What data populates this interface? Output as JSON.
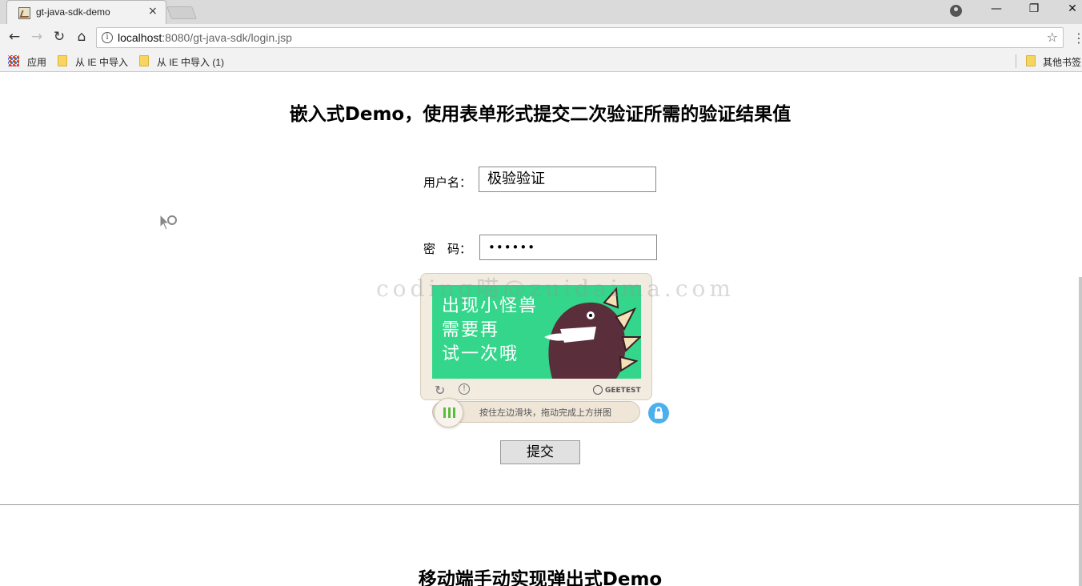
{
  "browser": {
    "tab_title": "gt-java-sdk-demo",
    "tab_close": "×",
    "url_host": "localhost",
    "url_path": ":8080/gt-java-sdk/login.jsp",
    "window_controls": {
      "minimize": "—",
      "maximize": "❐",
      "close": "✕"
    },
    "nav": {
      "back": "←",
      "forward": "→",
      "reload": "↻",
      "home": "⌂"
    },
    "star": "☆",
    "menu": "⋮",
    "info": "i"
  },
  "bookmarks": {
    "apps": "应用",
    "items": [
      "从 IE 中导入",
      "从 IE 中导入 (1)"
    ],
    "other": "其他书签"
  },
  "embed_demo": {
    "title": "嵌入式Demo，使用表单形式提交二次验证所需的验证结果值",
    "username_label": "用户名：",
    "username_value": "极验验证",
    "password_label": "密　码：",
    "password_value": "••••••",
    "submit_label": "提交"
  },
  "watermark": "coding喵@zuidaima.com",
  "captcha": {
    "image_lines": [
      "出现小怪兽",
      "需要再",
      "试一次哦"
    ],
    "refresh_icon": "↻",
    "info_icon": "!",
    "brand": "GEETEST",
    "slider_hint": "按住左边滑块，拖动完成上方拼图",
    "colors": {
      "image_bg": "#33d68a",
      "knob_bars": "#5dbb3f",
      "lock": "#4cb0f0"
    }
  },
  "mobile_demo": {
    "title": "移动端手动实现弹出式Demo"
  }
}
